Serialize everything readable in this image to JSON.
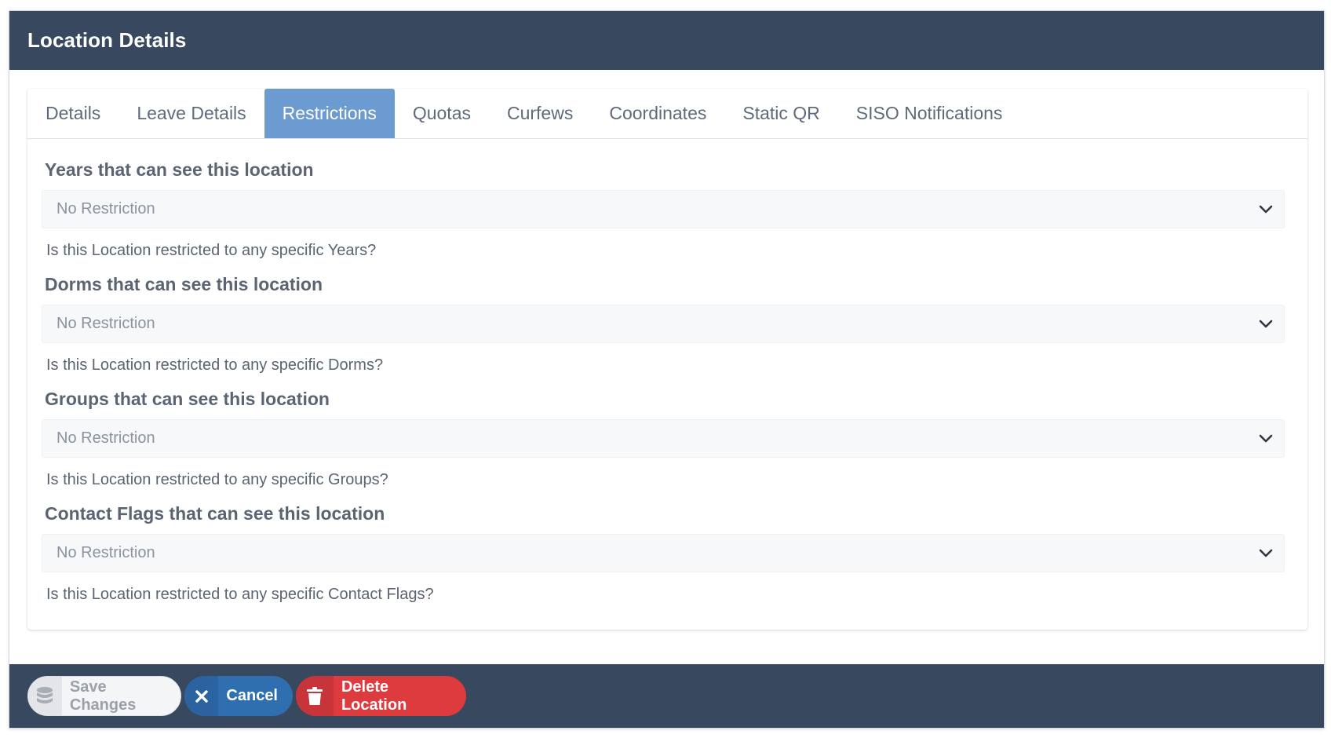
{
  "modal": {
    "title": "Location Details"
  },
  "tabs": [
    {
      "label": "Details",
      "active": false
    },
    {
      "label": "Leave Details",
      "active": false
    },
    {
      "label": "Restrictions",
      "active": true
    },
    {
      "label": "Quotas",
      "active": false
    },
    {
      "label": "Curfews",
      "active": false
    },
    {
      "label": "Coordinates",
      "active": false
    },
    {
      "label": "Static QR",
      "active": false
    },
    {
      "label": "SISO Notifications",
      "active": false
    }
  ],
  "restrictions": [
    {
      "label": "Years that can see this location",
      "value": "No Restriction",
      "help": "Is this Location restricted to any specific Years?"
    },
    {
      "label": "Dorms that can see this location",
      "value": "No Restriction",
      "help": "Is this Location restricted to any specific Dorms?"
    },
    {
      "label": "Groups that can see this location",
      "value": "No Restriction",
      "help": "Is this Location restricted to any specific Groups?"
    },
    {
      "label": "Contact Flags that can see this location",
      "value": "No Restriction",
      "help": "Is this Location restricted to any specific Contact Flags?"
    }
  ],
  "footer": {
    "save_label": "Save Changes",
    "cancel_label": "Cancel",
    "delete_label": "Delete Location"
  },
  "colors": {
    "header_bg": "#38485e",
    "active_tab": "#6c9bd2",
    "cancel": "#2f6fb0",
    "delete": "#de3b3f"
  },
  "icons": {
    "save": "database-icon",
    "cancel": "close-icon",
    "delete": "trash-icon",
    "select": "chevron-down-icon"
  }
}
